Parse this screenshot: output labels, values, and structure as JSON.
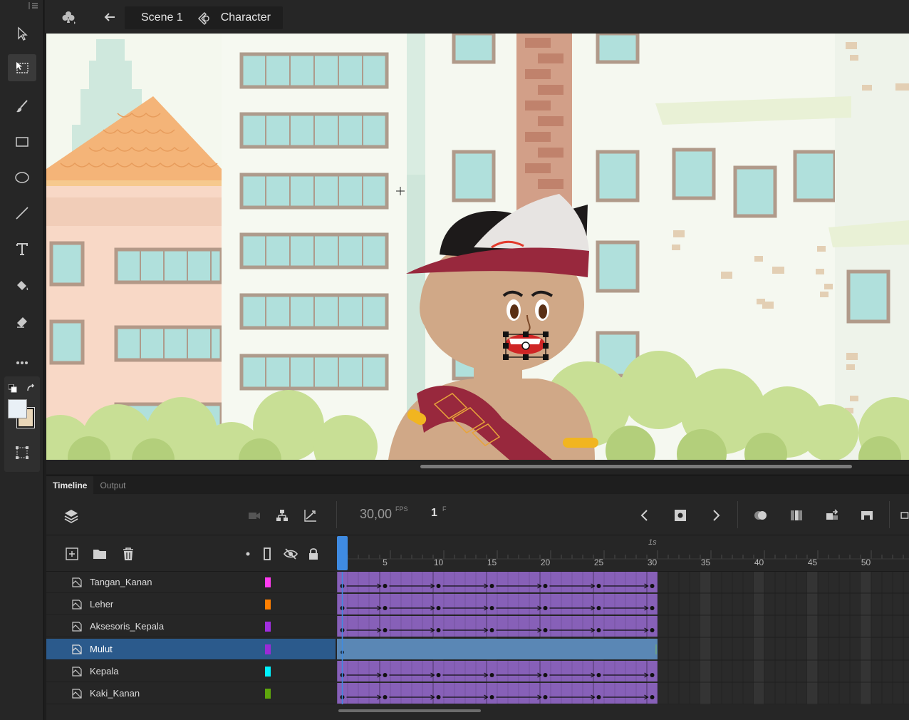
{
  "header": {
    "scene_label": "Scene 1",
    "symbol_label": "Character"
  },
  "panel": {
    "tabs": [
      {
        "label": "Timeline"
      },
      {
        "label": "Output"
      }
    ],
    "fps_value": "30,00",
    "fps_unit": "FPS",
    "current_frame": "1",
    "frame_unit": "F"
  },
  "ruler": {
    "second_marker": "1s",
    "labels": [
      "5",
      "10",
      "15",
      "20",
      "25",
      "30",
      "35",
      "40",
      "45",
      "50"
    ],
    "playhead_frame": 1,
    "span_end_frame": 30
  },
  "layers": [
    {
      "name": "Tangan_Kanan",
      "color": "#ff3cf0",
      "selected": false
    },
    {
      "name": "Leher",
      "color": "#ff7f00",
      "selected": false
    },
    {
      "name": "Aksesoris_Kepala",
      "color": "#a12ee0",
      "selected": false
    },
    {
      "name": "Mulut",
      "color": "#9b2ad6",
      "selected": true
    },
    {
      "name": "Kepala",
      "color": "#00f2ff",
      "selected": false
    },
    {
      "name": "Kaki_Kanan",
      "color": "#5ea60c",
      "selected": false
    }
  ],
  "keyframes": [
    1,
    5,
    10,
    15,
    20,
    25,
    30
  ],
  "colors": {
    "tween_fill": "#8760b8",
    "selected_fill": "#5a87b5",
    "accent_blue": "#3f8be2"
  }
}
